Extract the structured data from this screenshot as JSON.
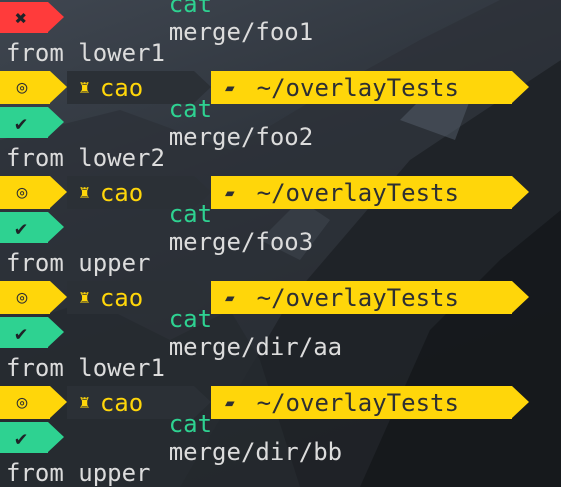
{
  "colors": {
    "error": "#ff3b3b",
    "success": "#2ed291",
    "prompt_yellow": "#ffd60a",
    "prompt_dark": "#2b3036",
    "output_text": "#dcdcdc"
  },
  "prompt": {
    "os_icon": "ubuntu-icon",
    "os_glyph": "◎",
    "user_icon": "user-icon",
    "user_glyph": "♜",
    "user": "cao",
    "folder_icon": "folder-open-icon",
    "folder_glyph": "▰",
    "path": "~/overlayTests"
  },
  "lines": [
    {
      "kind": "command",
      "status": "error",
      "status_icon": "close-icon",
      "glyph": "✖",
      "cmd": "cat",
      "arg": "merge/foo1"
    },
    {
      "kind": "output",
      "text": "from lower1"
    },
    {
      "kind": "prompt"
    },
    {
      "kind": "command",
      "status": "ok",
      "status_icon": "check-icon",
      "glyph": "✔",
      "cmd": "cat",
      "arg": "merge/foo2"
    },
    {
      "kind": "output",
      "text": "from lower2"
    },
    {
      "kind": "prompt"
    },
    {
      "kind": "command",
      "status": "ok",
      "status_icon": "check-icon",
      "glyph": "✔",
      "cmd": "cat",
      "arg": "merge/foo3"
    },
    {
      "kind": "output",
      "text": "from upper"
    },
    {
      "kind": "prompt"
    },
    {
      "kind": "command",
      "status": "ok",
      "status_icon": "check-icon",
      "glyph": "✔",
      "cmd": "cat",
      "arg": "merge/dir/aa"
    },
    {
      "kind": "output",
      "text": "from lower1"
    },
    {
      "kind": "prompt"
    },
    {
      "kind": "command",
      "status": "ok",
      "status_icon": "check-icon",
      "glyph": "✔",
      "cmd": "cat",
      "arg": "merge/dir/bb"
    },
    {
      "kind": "output",
      "text": "from upper"
    }
  ]
}
